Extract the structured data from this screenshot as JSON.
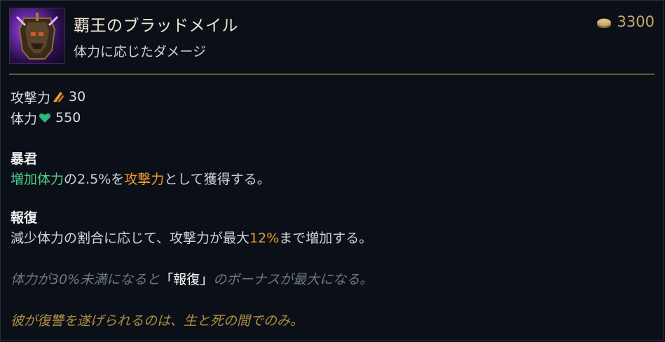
{
  "item": {
    "name": "覇王のブラッドメイル",
    "subtitle": "体力に応じたダメージ",
    "cost": "3300",
    "icon": "armor-helmet-icon"
  },
  "stats": [
    {
      "label": "攻撃力",
      "icon": "attack-damage-icon",
      "value": "30",
      "color": "#f09a2f"
    },
    {
      "label": "体力",
      "icon": "health-heart-icon",
      "value": "550",
      "color": "#2fb67a"
    }
  ],
  "passive1": {
    "title": "暴君",
    "part1": "増加体力",
    "part2": "の2.5%を",
    "part3": "攻撃力",
    "part4": "として獲得する。"
  },
  "passive2": {
    "title": "報復",
    "part1": "減少体力の割合に応じて、攻撃力が最大",
    "part2": "12%",
    "part3": "まで増加する。"
  },
  "note": {
    "part1": "体力が30%未満になると",
    "bracket": "「報復」",
    "part2": "のボーナスが最大になる。"
  },
  "flavor": "彼が復讐を遂げられるのは、生と死の間でのみ。",
  "colors": {
    "gold": "#c8aa6e",
    "green": "#4ecf86",
    "orange": "#f09a2f"
  }
}
